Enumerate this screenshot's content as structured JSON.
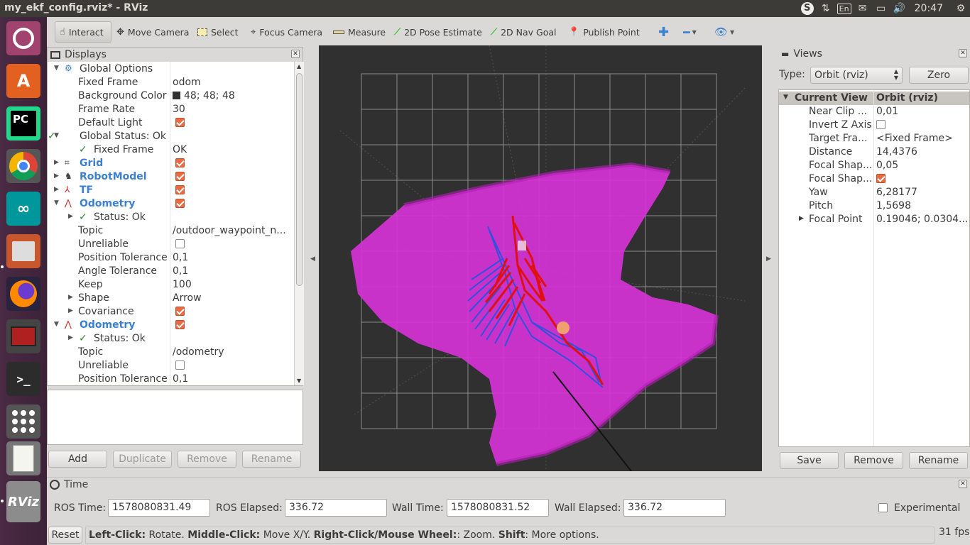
{
  "window": {
    "title": "my_ekf_config.rviz* - RViz"
  },
  "tray": {
    "keyboard": "En",
    "clock": "20:47"
  },
  "launcher": {
    "items": [
      "ubuntu-icon",
      "software-center-icon",
      "pycharm-icon",
      "chrome-icon",
      "arduino-icon",
      "files-icon",
      "firefox-icon",
      "system-monitor-icon",
      "terminal-icon",
      "apps-grid-icon",
      "text-editor-icon",
      "rviz-icon"
    ],
    "pycharm_label": "PC",
    "rviz_label": "RViz"
  },
  "toolbar": {
    "interact": "Interact",
    "move_camera": "Move Camera",
    "select": "Select",
    "focus_camera": "Focus Camera",
    "measure": "Measure",
    "pose_estimate": "2D Pose Estimate",
    "nav_goal": "2D Nav Goal",
    "publish_point": "Publish Point"
  },
  "displays": {
    "title": "Displays",
    "rows": [
      {
        "label": "Global Options",
        "value": ""
      },
      {
        "label": "Fixed Frame",
        "value": "odom"
      },
      {
        "label": "Background Color",
        "value": "48; 48; 48"
      },
      {
        "label": "Frame Rate",
        "value": "30"
      },
      {
        "label": "Default Light",
        "value": ""
      },
      {
        "label": "Global Status: Ok",
        "value": ""
      },
      {
        "label": "Fixed Frame",
        "value": "OK"
      },
      {
        "label": "Grid",
        "value": ""
      },
      {
        "label": "RobotModel",
        "value": ""
      },
      {
        "label": "TF",
        "value": ""
      },
      {
        "label": "Odometry",
        "value": ""
      },
      {
        "label": "Status: Ok",
        "value": ""
      },
      {
        "label": "Topic",
        "value": "/outdoor_waypoint_n..."
      },
      {
        "label": "Unreliable",
        "value": ""
      },
      {
        "label": "Position Tolerance",
        "value": "0,1"
      },
      {
        "label": "Angle Tolerance",
        "value": "0,1"
      },
      {
        "label": "Keep",
        "value": "100"
      },
      {
        "label": "Shape",
        "value": "Arrow"
      },
      {
        "label": "Covariance",
        "value": ""
      },
      {
        "label": "Odometry",
        "value": ""
      },
      {
        "label": "Status: Ok",
        "value": ""
      },
      {
        "label": "Topic",
        "value": "/odometry"
      },
      {
        "label": "Unreliable",
        "value": ""
      },
      {
        "label": "Position Tolerance",
        "value": "0,1"
      }
    ],
    "buttons": {
      "add": "Add",
      "duplicate": "Duplicate",
      "remove": "Remove",
      "rename": "Rename"
    }
  },
  "views": {
    "title": "Views",
    "type_label": "Type:",
    "type_value": "Orbit (rviz)",
    "zero": "Zero",
    "header": {
      "label": "Current View",
      "value": "Orbit (rviz)"
    },
    "rows": [
      {
        "label": "Near Clip ...",
        "value": "0,01"
      },
      {
        "label": "Invert Z Axis",
        "value": ""
      },
      {
        "label": "Target Fra...",
        "value": "<Fixed Frame>"
      },
      {
        "label": "Distance",
        "value": "14,4376"
      },
      {
        "label": "Focal Shap...",
        "value": "0,05"
      },
      {
        "label": "Focal Shap...",
        "value": ""
      },
      {
        "label": "Yaw",
        "value": "6,28177"
      },
      {
        "label": "Pitch",
        "value": "1,5698"
      },
      {
        "label": "Focal Point",
        "value": "0.19046; 0.0304..."
      }
    ],
    "buttons": {
      "save": "Save",
      "remove": "Remove",
      "rename": "Rename"
    }
  },
  "time": {
    "title": "Time",
    "ros_time_label": "ROS Time:",
    "ros_time": "1578080831.49",
    "ros_elapsed_label": "ROS Elapsed:",
    "ros_elapsed": "336.72",
    "wall_time_label": "Wall Time:",
    "wall_time": "1578080831.52",
    "wall_elapsed_label": "Wall Elapsed:",
    "wall_elapsed": "336.72",
    "experimental": "Experimental"
  },
  "status": {
    "reset": "Reset",
    "hint_left_key": "Left-Click:",
    "hint_left": " Rotate. ",
    "hint_middle_key": "Middle-Click:",
    "hint_middle": " Move X/Y. ",
    "hint_right_key": "Right-Click/Mouse Wheel:",
    "hint_right": ": Zoom. ",
    "hint_shift_key": "Shift",
    "hint_shift": ": More options.",
    "fps": "31 fps"
  },
  "colors": {
    "accent": "#e96b44",
    "covariance": "#d733d7",
    "odom_red": "#e01010",
    "odom_blue": "#3050e0",
    "background": "#303030"
  }
}
